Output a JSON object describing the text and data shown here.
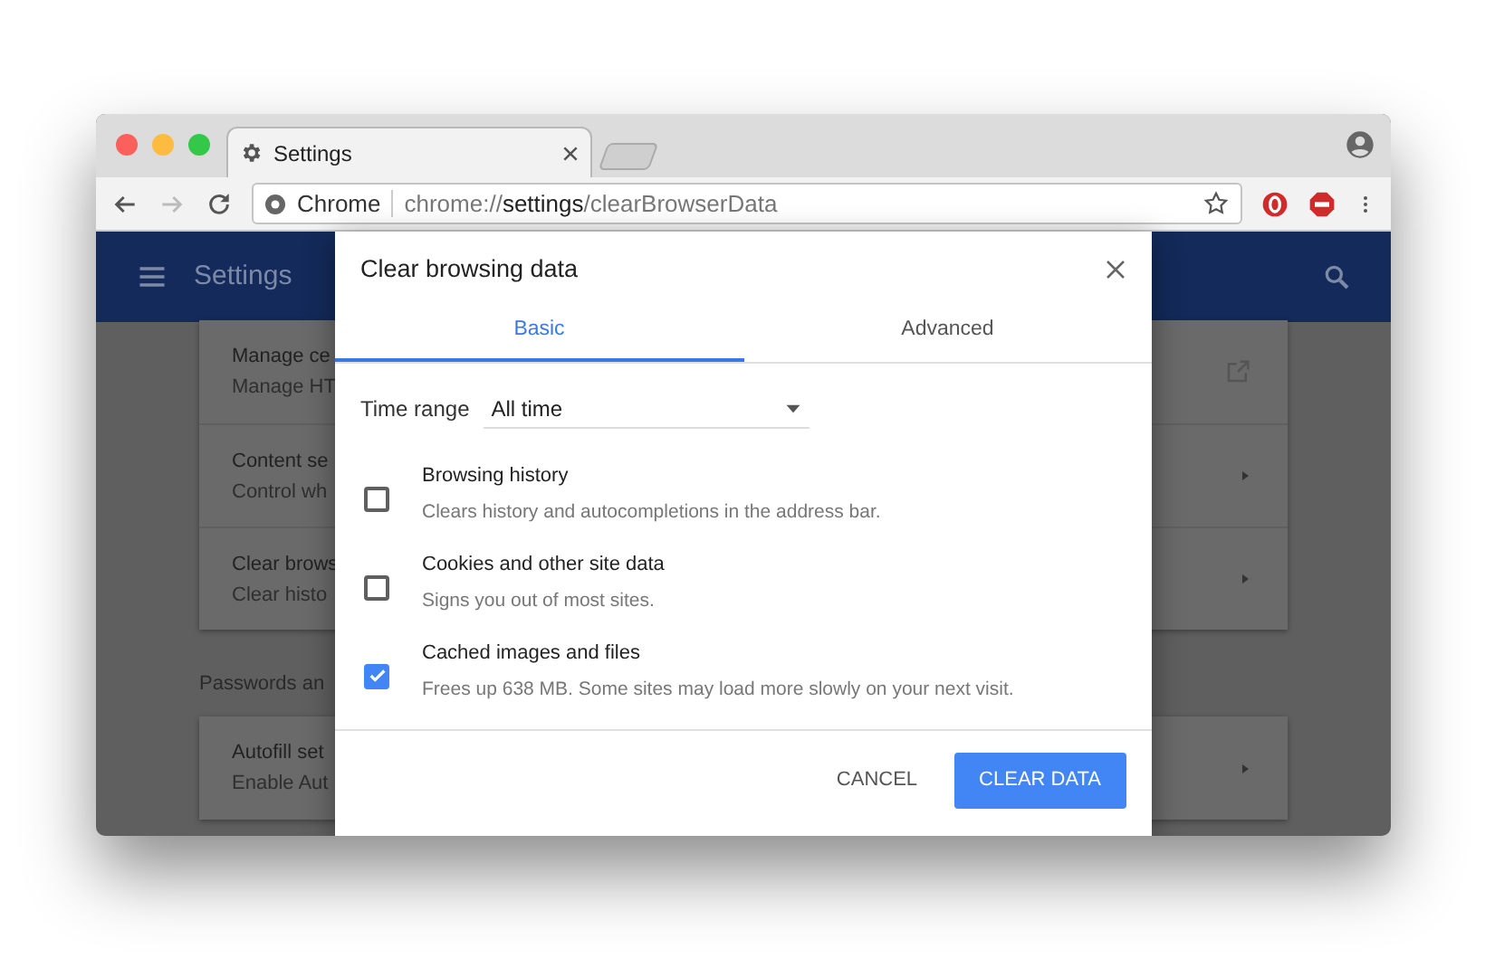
{
  "browser": {
    "tab": {
      "title": "Settings"
    },
    "address": {
      "site_label": "Chrome",
      "url_scheme": "chrome://",
      "url_host": "settings",
      "url_path": "/clearBrowserData"
    }
  },
  "settings": {
    "title": "Settings",
    "cards": [
      {
        "items": [
          {
            "title": "Manage ce",
            "subtitle": "Manage HT",
            "kind": "external"
          },
          {
            "title": "Content se",
            "subtitle": "Control wh",
            "kind": "arrow"
          },
          {
            "title": "Clear brows",
            "subtitle": "Clear histo",
            "kind": "arrow"
          }
        ]
      },
      {
        "section": "Passwords an",
        "items": [
          {
            "title": "Autofill set",
            "subtitle": "Enable Aut",
            "kind": "arrow"
          }
        ]
      }
    ]
  },
  "dialog": {
    "title": "Clear browsing data",
    "tabs": [
      {
        "label": "Basic",
        "selected": true
      },
      {
        "label": "Advanced",
        "selected": false
      }
    ],
    "time_range": {
      "label": "Time range",
      "value": "All time"
    },
    "options": [
      {
        "title": "Browsing history",
        "description": "Clears history and autocompletions in the address bar.",
        "checked": false
      },
      {
        "title": "Cookies and other site data",
        "description": "Signs you out of most sites.",
        "checked": false
      },
      {
        "title": "Cached images and files",
        "description": "Frees up 638 MB. Some sites may load more slowly on your next visit.",
        "checked": true
      }
    ],
    "buttons": [
      {
        "label": "CANCEL",
        "kind": "text"
      },
      {
        "label": "CLEAR DATA",
        "kind": "primary"
      }
    ]
  }
}
